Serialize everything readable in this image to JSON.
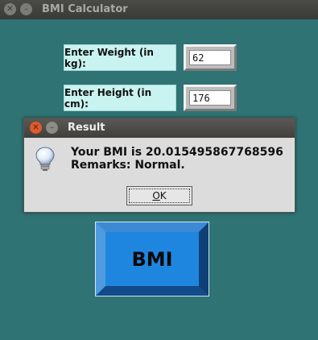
{
  "window": {
    "title": "BMI Calculator",
    "close_glyph": "✕",
    "minimize_glyph": "–"
  },
  "form": {
    "weight_label": "Enter Weight (in kg):",
    "weight_value": "62",
    "height_label": "Enter Height (in cm):",
    "height_value": "176"
  },
  "dialog": {
    "title": "Result",
    "close_glyph": "✕",
    "minimize_glyph": "–",
    "icon": "lightbulb-icon",
    "line1": "Your BMI is 20.015495867768596",
    "line2": "Remarks: Normal.",
    "ok_mnemonic": "O",
    "ok_rest": "K"
  },
  "bmi_button": {
    "label": "BMI"
  },
  "colors": {
    "background": "#2f7374",
    "label_bg": "#c9f3f1",
    "bmi_face": "#1f86e0",
    "dialog_close": "#e05a2a"
  }
}
